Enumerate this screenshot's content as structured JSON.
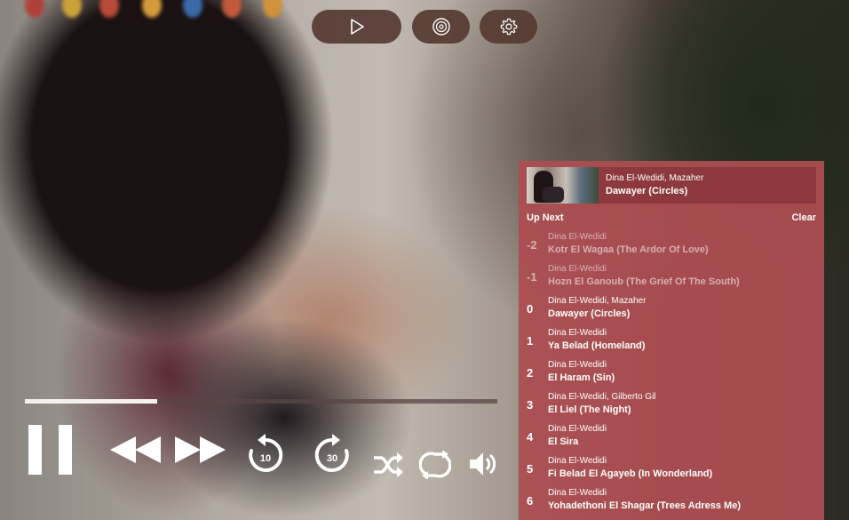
{
  "top_controls": [
    {
      "name": "play-mode-button",
      "icon": "play-icon"
    },
    {
      "name": "disc-button",
      "icon": "disc-icon"
    },
    {
      "name": "settings-button",
      "icon": "gear-icon"
    }
  ],
  "playback": {
    "progress": 0.28,
    "state": "playing",
    "rewind_seconds": "10",
    "forward_seconds": "30"
  },
  "now_playing": {
    "artist": "Dina El-Wedidi, Mazaher",
    "title": "Dawayer (Circles)"
  },
  "queue_header": {
    "label": "Up Next",
    "clear_label": "Clear"
  },
  "queue": [
    {
      "index": "-2",
      "artist": "Dina El-Wedidi",
      "title": "Kotr El Wagaa (The Ardor Of Love)",
      "past": true
    },
    {
      "index": "-1",
      "artist": "Dina El-Wedidi",
      "title": "Hozn El Ganoub (The Grief Of The South)",
      "past": true
    },
    {
      "index": "0",
      "artist": "Dina El-Wedidi, Mazaher",
      "title": "Dawayer (Circles)",
      "past": false
    },
    {
      "index": "1",
      "artist": "Dina El-Wedidi",
      "title": "Ya Belad (Homeland)",
      "past": false
    },
    {
      "index": "2",
      "artist": "Dina El-Wedidi",
      "title": "El Haram (Sin)",
      "past": false
    },
    {
      "index": "3",
      "artist": "Dina El-Wedidi, Gilberto Gil",
      "title": "El Liel (The Night)",
      "past": false
    },
    {
      "index": "4",
      "artist": "Dina El-Wedidi",
      "title": "El Sira",
      "past": false
    },
    {
      "index": "5",
      "artist": "Dina El-Wedidi",
      "title": "Fi Belad El Agayeb (In Wonderland)",
      "past": false
    },
    {
      "index": "6",
      "artist": "Dina El-Wedidi",
      "title": "Yohadethoni El Shagar (Trees Adress Me)",
      "past": false
    }
  ],
  "colors": {
    "panel": "#ac4e52",
    "button_bg": "#563a32",
    "progress_fill": "#f3f0ee"
  }
}
